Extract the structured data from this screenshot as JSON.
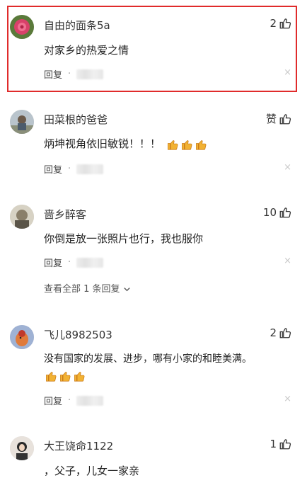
{
  "comments": [
    {
      "name": "自由的面条5a",
      "likes": "2",
      "text": "对家乡的热爱之情",
      "reply": "回复",
      "dot": "·",
      "close": "×"
    },
    {
      "name": "田菜根的爸爸",
      "likes": "赞",
      "text": "炳坤视角依旧敏锐！！！",
      "reply": "回复",
      "dot": "·",
      "close": "×"
    },
    {
      "name": "啬乡醉客",
      "likes": "10",
      "text": "你倒是放一张照片也行，我也服你",
      "reply": "回复",
      "dot": "·",
      "close": "×",
      "view_all": "查看全部 1 条回复"
    },
    {
      "name": "飞儿8982503",
      "likes": "2",
      "text": "没有国家的发展、进步，哪有小家的和睦美满。",
      "reply": "回复",
      "dot": "·",
      "close": "×"
    },
    {
      "name": "大王饶命1122",
      "likes": "1",
      "text": "，父子，儿女一家亲"
    }
  ],
  "colors": {
    "highlight": "#e02b2b",
    "text": "#222222",
    "muted": "#999999"
  },
  "icons": {
    "like": "thumbs-up-icon",
    "emoji": "thumbs-up-emoji",
    "chevron": "chevron-down-icon"
  }
}
